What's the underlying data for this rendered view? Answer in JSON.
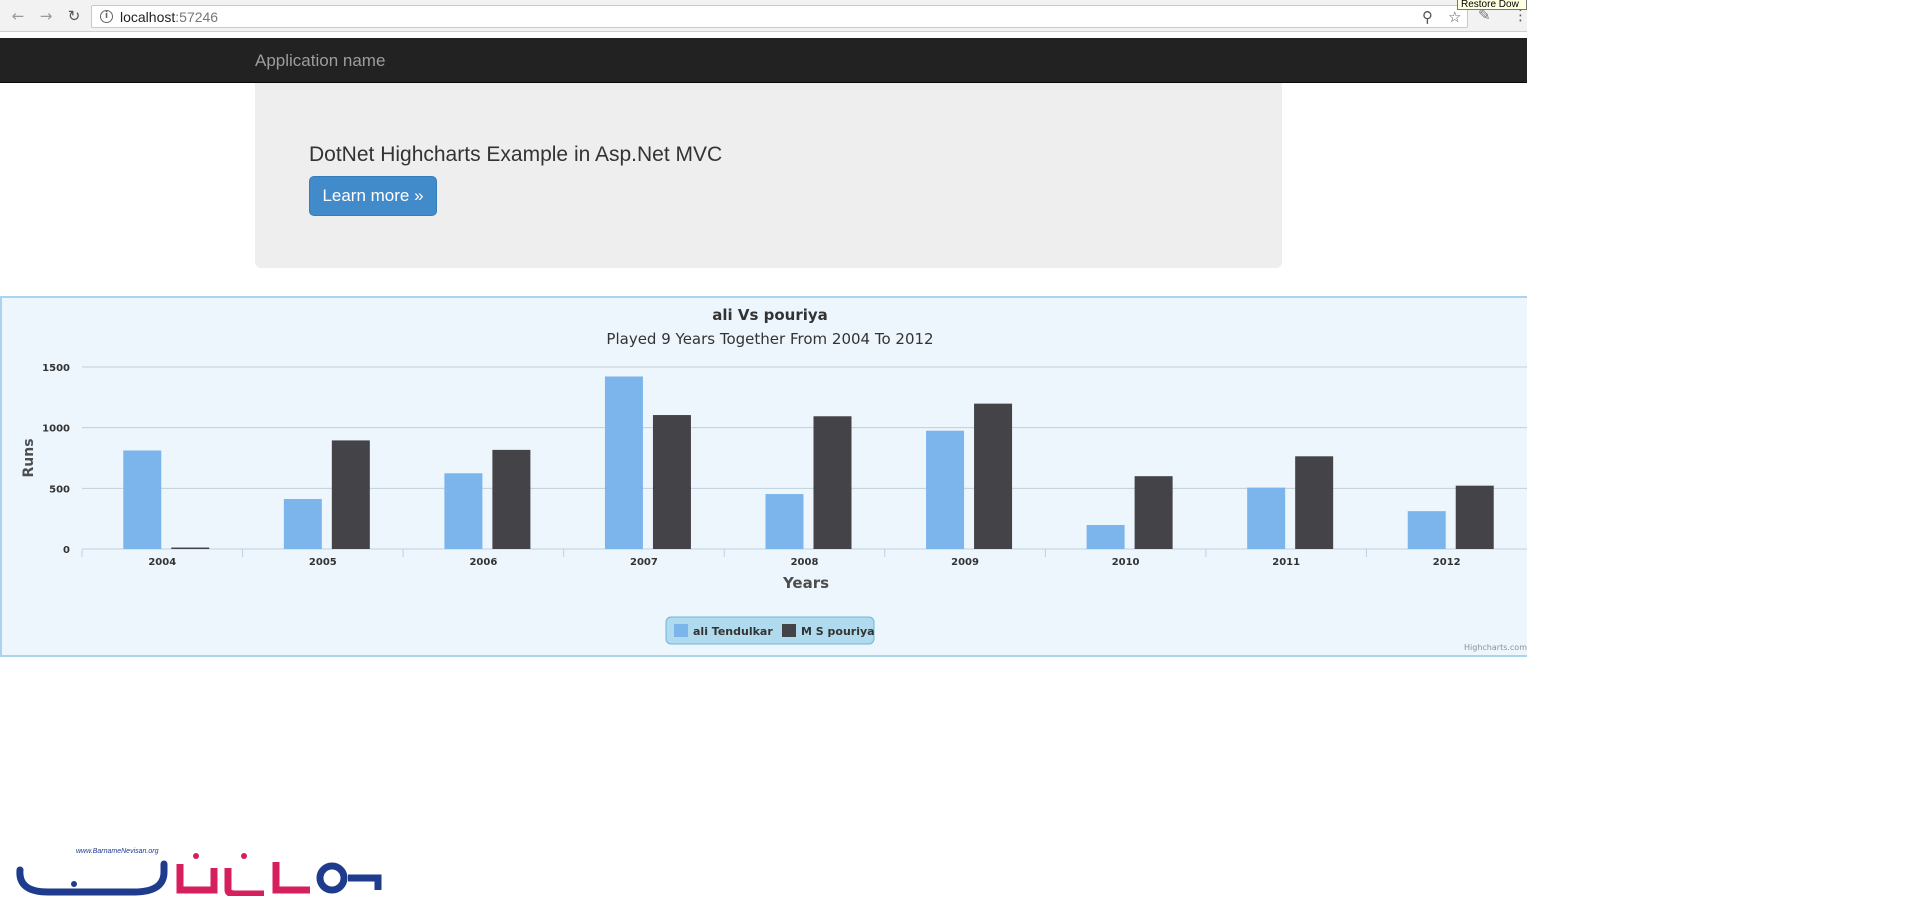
{
  "browser": {
    "url_host": "localhost",
    "url_port": ":57246",
    "tooltip": "Restore Dow",
    "icons": [
      "back-arrow-icon",
      "forward-arrow-icon",
      "reload-icon",
      "info-icon",
      "zoom-icon",
      "star-icon",
      "extension-icon",
      "menu-icon"
    ]
  },
  "navbar": {
    "brand": "Application name"
  },
  "jumbotron": {
    "title": "DotNet Highcharts Example in Asp.Net MVC",
    "button": "Learn more »"
  },
  "chart_data": {
    "type": "bar",
    "title": "ali Vs pouriya",
    "subtitle": "Played 9 Years Together From 2004 To 2012",
    "xlabel": "Years",
    "ylabel": "Runs",
    "categories": [
      "2004",
      "2005",
      "2006",
      "2007",
      "2008",
      "2009",
      "2010",
      "2011",
      "2012"
    ],
    "series": [
      {
        "name": "ali Tendulkar",
        "color": "#7cb5ec",
        "values": [
          812,
          412,
          624,
          1422,
          453,
          975,
          198,
          506,
          312
        ]
      },
      {
        "name": "M S pouriya",
        "color": "#434348",
        "values": [
          12,
          895,
          817,
          1104,
          1094,
          1198,
          600,
          764,
          522
        ]
      }
    ],
    "ylim": [
      0,
      1500
    ],
    "yticks": [
      "0",
      "500",
      "1000",
      "1500"
    ],
    "grid": true,
    "legend_position": "bottom-center",
    "legend_background": "#b0dbee",
    "background": "#eef6fd",
    "credits": "Highcharts.com"
  },
  "logo": {
    "url_text": "www.BarnameNevisan.org",
    "brand_text": "برنامه نویسان"
  }
}
